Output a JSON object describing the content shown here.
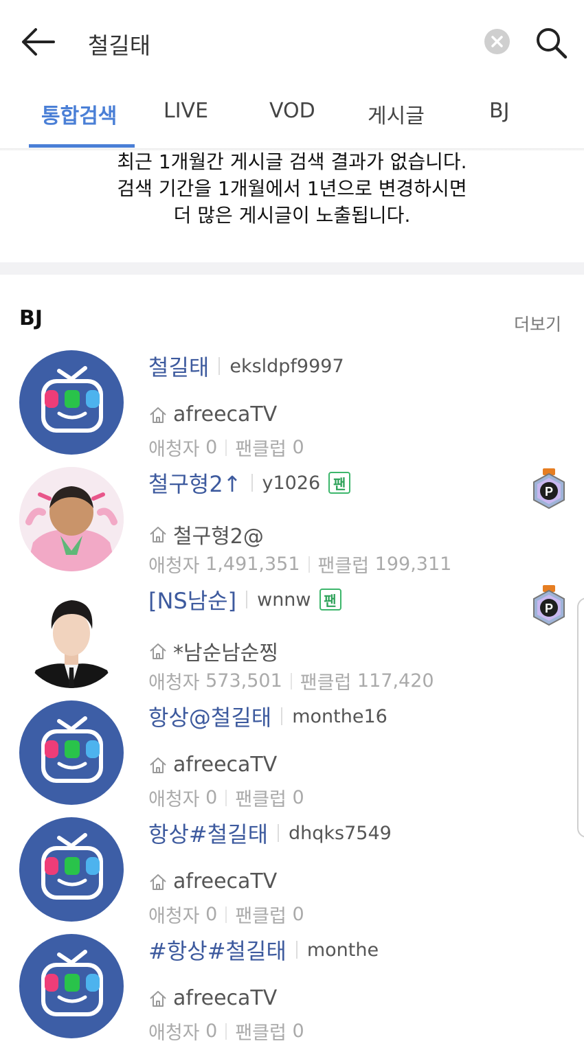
{
  "header": {
    "search_query": "철길태"
  },
  "tabs": [
    {
      "label": "통합검색",
      "active": true
    },
    {
      "label": "LIVE",
      "active": false
    },
    {
      "label": "VOD",
      "active": false
    },
    {
      "label": "게시글",
      "active": false
    },
    {
      "label": "BJ",
      "active": false
    }
  ],
  "notice": {
    "line1": "최근 1개월간 게시글 검색 결과가 없습니다.",
    "line2": "검색 기간을 1개월에서 1년으로 변경하시면",
    "line3": "더 많은 게시글이 노출됩니다."
  },
  "bj_section": {
    "title": "BJ",
    "more_label": "더보기",
    "items": [
      {
        "name": "철길태",
        "id": "eksldpf9997",
        "fan_badge": "",
        "station": "afreecaTV",
        "viewers_label": "애청자",
        "viewers": "0",
        "fanclub_label": "팬클럽",
        "fanclub": "0",
        "medal": false
      },
      {
        "name": "철구형2↑",
        "id": "y1026",
        "fan_badge": "팬",
        "station": "철구형2@",
        "viewers_label": "애청자",
        "viewers": "1,491,351",
        "fanclub_label": "팬클럽",
        "fanclub": "199,311",
        "medal": true,
        "medal_letter": "P"
      },
      {
        "name": "[NS남순]",
        "id": "wnnw",
        "fan_badge": "팬",
        "station": "*남순남순찡",
        "viewers_label": "애청자",
        "viewers": "573,501",
        "fanclub_label": "팬클럽",
        "fanclub": "117,420",
        "medal": true,
        "medal_letter": "P"
      },
      {
        "name": "항상@철길태",
        "id": "monthe16",
        "fan_badge": "",
        "station": "afreecaTV",
        "viewers_label": "애청자",
        "viewers": "0",
        "fanclub_label": "팬클럽",
        "fanclub": "0",
        "medal": false
      },
      {
        "name": "항상#철길태",
        "id": "dhqks7549",
        "fan_badge": "",
        "station": "afreecaTV",
        "viewers_label": "애청자",
        "viewers": "0",
        "fanclub_label": "팬클럽",
        "fanclub": "0",
        "medal": false
      },
      {
        "name": "#항상#철길태",
        "id": "monthe",
        "fan_badge": "",
        "station": "afreecaTV",
        "viewers_label": "애청자",
        "viewers": "0",
        "fanclub_label": "팬클럽",
        "fanclub": "0",
        "medal": false
      }
    ]
  },
  "colors": {
    "accent": "#4a7fd6",
    "bj_name": "#3d5a9e",
    "avatar_bg": "#3d5ea6",
    "fan_badge": "#3cb66b"
  }
}
